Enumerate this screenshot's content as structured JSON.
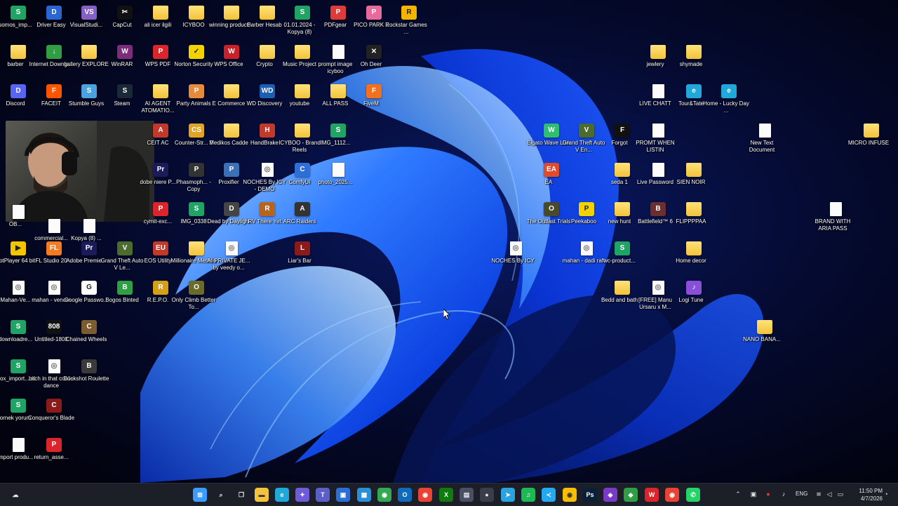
{
  "icons": [
    {
      "label": "somos_imp...",
      "glyph": "S",
      "type": "app",
      "color": "#21a366"
    },
    {
      "label": "Driver Easy",
      "glyph": "D",
      "type": "app",
      "color": "#2a66d1"
    },
    {
      "label": "VisualStudi...",
      "glyph": "VS",
      "type": "app",
      "color": "#8661c5"
    },
    {
      "label": "CapCut",
      "glyph": "✂",
      "type": "app",
      "color": "#111111"
    },
    {
      "label": "ali icer ilgili",
      "glyph": "",
      "type": "folder",
      "color": "#f3c33b"
    },
    {
      "label": "ICYBOO",
      "glyph": "",
      "type": "folder",
      "color": "#f3c33b"
    },
    {
      "label": "winning product",
      "glyph": "",
      "type": "folder",
      "color": "#f3c33b"
    },
    {
      "label": "Barber Hesab",
      "glyph": "",
      "type": "folder",
      "color": "#f3c33b"
    },
    {
      "label": "01.01.2024 - Kopya (8)",
      "glyph": "S",
      "type": "app",
      "color": "#21a366"
    },
    {
      "label": "PDFgear",
      "glyph": "P",
      "type": "app",
      "color": "#e03b3b"
    },
    {
      "label": "PICO PARK 2",
      "glyph": "P",
      "type": "app",
      "color": "#e86a9c"
    },
    {
      "label": "Rockstar Games ...",
      "glyph": "R",
      "type": "app",
      "color": "#f5b400"
    },
    {
      "label": "barber",
      "glyph": "",
      "type": "folder",
      "color": "#f3c33b"
    },
    {
      "label": "Internet Downlo...",
      "glyph": "↓",
      "type": "app",
      "color": "#2f9e44"
    },
    {
      "label": "gallery EXPLORE",
      "glyph": "",
      "type": "folder",
      "color": "#f3c33b"
    },
    {
      "label": "WinRAR",
      "glyph": "W",
      "type": "app",
      "color": "#7b2c7b"
    },
    {
      "label": "WPS PDF",
      "glyph": "P",
      "type": "app",
      "color": "#d9252b"
    },
    {
      "label": "Norton Security",
      "glyph": "✓",
      "type": "app",
      "color": "#f2d200"
    },
    {
      "label": "WPS Office",
      "glyph": "W",
      "type": "app",
      "color": "#c9202a"
    },
    {
      "label": "Crypto",
      "glyph": "",
      "type": "folder",
      "color": "#f3c33b"
    },
    {
      "label": "Music Project",
      "glyph": "",
      "type": "folder",
      "color": "#f3c33b"
    },
    {
      "label": "prompt image icyboo",
      "glyph": "",
      "type": "doc",
      "color": "#fbfbfb"
    },
    {
      "label": "Oh Deer",
      "glyph": "✕",
      "type": "app",
      "color": "#222222"
    },
    {
      "label": "Discord",
      "glyph": "D",
      "type": "app",
      "color": "#5865f2"
    },
    {
      "label": "FACEIT",
      "glyph": "F",
      "type": "app",
      "color": "#ff5500"
    },
    {
      "label": "Stumble Guys",
      "glyph": "S",
      "type": "app",
      "color": "#4aa3df"
    },
    {
      "label": "Steam",
      "glyph": "S",
      "type": "app",
      "color": "#1b2838"
    },
    {
      "label": "AI AGENT ATOMATIO...",
      "glyph": "",
      "type": "folder",
      "color": "#f3c33b"
    },
    {
      "label": "Party Animals",
      "glyph": "P",
      "type": "app",
      "color": "#e58b3a"
    },
    {
      "label": "E Commerce",
      "glyph": "",
      "type": "folder",
      "color": "#f3c33b"
    },
    {
      "label": "WD Discovery",
      "glyph": "WD",
      "type": "app",
      "color": "#1a5fb4"
    },
    {
      "label": "youtube",
      "glyph": "",
      "type": "folder",
      "color": "#f3c33b"
    },
    {
      "label": "ALL PASS",
      "glyph": "",
      "type": "folder",
      "color": "#f3c33b"
    },
    {
      "label": "FiveM",
      "glyph": "F",
      "type": "app",
      "color": "#f37021"
    },
    {
      "label": "CEIT AC",
      "glyph": "A",
      "type": "app",
      "color": "#c0392b"
    },
    {
      "label": "Counter-Str... 2",
      "glyph": "CS",
      "type": "app",
      "color": "#e0a526"
    },
    {
      "label": "Medikos Cadde",
      "glyph": "",
      "type": "folder",
      "color": "#c9a25b"
    },
    {
      "label": "HandBrake",
      "glyph": "H",
      "type": "app",
      "color": "#c0392b"
    },
    {
      "label": "ICYBOO - Brand Reels",
      "glyph": "",
      "type": "folder",
      "color": "#f3c33b"
    },
    {
      "label": "IMG_1112...",
      "glyph": "S",
      "type": "app",
      "color": "#21a366"
    },
    {
      "label": "dobe niere P...",
      "glyph": "Pr",
      "type": "app",
      "color": "#1b1b5a"
    },
    {
      "label": "Phasmoph... - Copy",
      "glyph": "P",
      "type": "app",
      "color": "#333333"
    },
    {
      "label": "Proxifier",
      "glyph": "P",
      "type": "app",
      "color": "#3b6fb6"
    },
    {
      "label": "NOCHES By ICY - DEMO",
      "glyph": "◎",
      "type": "doc",
      "color": "#fbfbfb"
    },
    {
      "label": "ComfyUI",
      "glyph": "C",
      "type": "app",
      "color": "#2d6fd6"
    },
    {
      "label": "photo_2025...",
      "glyph": "",
      "type": "doc",
      "color": "#cccccc"
    },
    {
      "label": "cymit-exc...",
      "glyph": "P",
      "type": "app",
      "color": "#d9252b"
    },
    {
      "label": "IMG_0338",
      "glyph": "S",
      "type": "app",
      "color": "#21a366"
    },
    {
      "label": "Dead by Daylight",
      "glyph": "D",
      "type": "app",
      "color": "#444444"
    },
    {
      "label": "RV There Yet",
      "glyph": "R",
      "type": "app",
      "color": "#b5651d"
    },
    {
      "label": "ARC Raiders",
      "glyph": "A",
      "type": "app",
      "color": "#333333"
    },
    {
      "label": "PotPlayer 64 bit",
      "glyph": "▶",
      "type": "app",
      "color": "#f2c500"
    },
    {
      "label": "FL Studio 20",
      "glyph": "FL",
      "type": "app",
      "color": "#f47b20"
    },
    {
      "label": "Adobe Premie...",
      "glyph": "Pr",
      "type": "app",
      "color": "#1b1b5a"
    },
    {
      "label": "Grand Theft Auto V Le...",
      "glyph": "V",
      "type": "app",
      "color": "#4c6b2f"
    },
    {
      "label": "EOS Utility",
      "glyph": "EU",
      "type": "app",
      "color": "#c0392b"
    },
    {
      "label": "Millionaire Method",
      "glyph": "",
      "type": "folder",
      "color": "#f3c33b"
    },
    {
      "label": "AI PRIVATE JE... by veedy o...",
      "glyph": "◎",
      "type": "doc",
      "color": "#fbfbfb"
    },
    {
      "label": "Liar's Bar",
      "glyph": "L",
      "type": "app",
      "color": "#8b1a1a"
    },
    {
      "label": "Mahan-Ve...",
      "glyph": "◎",
      "type": "doc",
      "color": "#fbfbfb"
    },
    {
      "label": "mahan - venom",
      "glyph": "◎",
      "type": "doc",
      "color": "#fbfbfb"
    },
    {
      "label": "Google Passwo...",
      "glyph": "G",
      "type": "app",
      "color": "#ffffff"
    },
    {
      "label": "Bogos Binted",
      "glyph": "B",
      "type": "app",
      "color": "#2f9e44"
    },
    {
      "label": "R.E.P.O.",
      "glyph": "R",
      "type": "app",
      "color": "#d4a017"
    },
    {
      "label": "Only Climb Better To...",
      "glyph": "O",
      "type": "app",
      "color": "#6b6b2a"
    },
    {
      "label": "downloadre...",
      "glyph": "S",
      "type": "app",
      "color": "#21a366"
    },
    {
      "label": "Untitled-1808",
      "glyph": "808",
      "type": "app",
      "color": "#111111"
    },
    {
      "label": "Chained Wheels",
      "glyph": "C",
      "type": "app",
      "color": "#7a5c2e"
    },
    {
      "label": "loox_import... ai",
      "glyph": "S",
      "type": "app",
      "color": "#21a366"
    },
    {
      "label": "bitch in that coolie dance",
      "glyph": "◎",
      "type": "doc",
      "color": "#fbfbfb"
    },
    {
      "label": "Buckshot Roulette",
      "glyph": "B",
      "type": "app",
      "color": "#3a3a3a"
    },
    {
      "label": "ornek yorum",
      "glyph": "S",
      "type": "app",
      "color": "#21a366"
    },
    {
      "label": "Conqueror's Blade",
      "glyph": "C",
      "type": "app",
      "color": "#8b1a1a"
    },
    {
      "label": "import produ...",
      "glyph": "",
      "type": "doc",
      "color": "#fbfbfb"
    },
    {
      "label": "return_asse...",
      "glyph": "P",
      "type": "app",
      "color": "#d9252b"
    },
    {
      "label": "jewlery",
      "glyph": "",
      "type": "folder",
      "color": "#f3c33b"
    },
    {
      "label": "shymade",
      "glyph": "",
      "type": "folder",
      "color": "#f3c33b"
    },
    {
      "label": "LIVE CHATT",
      "glyph": "",
      "type": "doc",
      "color": "#fbfbfb"
    },
    {
      "label": "Tour&Tate",
      "glyph": "e",
      "type": "app",
      "color": "#1fa8d9"
    },
    {
      "label": "Home - Lucky Day ...",
      "glyph": "e",
      "type": "app",
      "color": "#1fa8d9"
    },
    {
      "label": "Elgato Wave Link",
      "glyph": "W",
      "type": "app",
      "color": "#2fbf71"
    },
    {
      "label": "Grand Theft Auto V En...",
      "glyph": "V",
      "type": "app",
      "color": "#4c6b2f"
    },
    {
      "label": "Forgot",
      "glyph": "F",
      "type": "app",
      "color": "#111111"
    },
    {
      "label": "PROMT WHEN LISTIN",
      "glyph": "",
      "type": "doc",
      "color": "#fbfbfb"
    },
    {
      "label": "New Text Document",
      "glyph": "",
      "type": "doc",
      "color": "#fbfbfb"
    },
    {
      "label": "MICRO INFUSE",
      "glyph": "",
      "type": "folder",
      "color": "#f3c33b"
    },
    {
      "label": "EA",
      "glyph": "EA",
      "type": "app",
      "color": "#e14b2b"
    },
    {
      "label": "seda 1",
      "glyph": "",
      "type": "folder",
      "color": "#f3c33b"
    },
    {
      "label": "Live Password",
      "glyph": "",
      "type": "doc",
      "color": "#fbfbfb"
    },
    {
      "label": "SIEN NOIR",
      "glyph": "",
      "type": "folder",
      "color": "#d4a017"
    },
    {
      "label": "The Outlast Trials",
      "glyph": "O",
      "type": "app",
      "color": "#4a4a2a"
    },
    {
      "label": "Peekaboo",
      "glyph": "P",
      "type": "app",
      "color": "#f2d200"
    },
    {
      "label": "new hunt",
      "glyph": "",
      "type": "folder",
      "color": "#f3c33b"
    },
    {
      "label": "Battlefield™ 6",
      "glyph": "B",
      "type": "app",
      "color": "#6b2f2f"
    },
    {
      "label": "FLIPPPPAA",
      "glyph": "",
      "type": "folder",
      "color": "#f3c33b"
    },
    {
      "label": "BRAND WITH ARIA PASS",
      "glyph": "",
      "type": "doc",
      "color": "#fbfbfb"
    },
    {
      "label": "NOCHES By ICY",
      "glyph": "◎",
      "type": "doc",
      "color": "#fbfbfb"
    },
    {
      "label": "mahan - dadi raft",
      "glyph": "◎",
      "type": "doc",
      "color": "#fbfbfb"
    },
    {
      "label": "wc-product...",
      "glyph": "S",
      "type": "app",
      "color": "#21a366"
    },
    {
      "label": "Home decor",
      "glyph": "",
      "type": "folder",
      "color": "#f3c33b"
    },
    {
      "label": "Bedd and bath",
      "glyph": "",
      "type": "folder",
      "color": "#f3c33b"
    },
    {
      "label": "[FREE] Manu Ursaru x M...",
      "glyph": "◎",
      "type": "doc",
      "color": "#fbfbfb"
    },
    {
      "label": "Logi Tune",
      "glyph": "♪",
      "type": "app",
      "color": "#8a4fd8"
    },
    {
      "label": "NANO BANA...",
      "glyph": "",
      "type": "folder",
      "color": "#f3c33b"
    },
    {
      "label": "commercial...",
      "glyph": "",
      "type": "doc",
      "color": "#fbfbfb"
    },
    {
      "label": "Kopya (8) ...",
      "glyph": "",
      "type": "doc",
      "color": "#fbfbfb"
    },
    {
      "label": "OB...",
      "glyph": "",
      "type": "doc",
      "color": "#fbfbfb"
    }
  ],
  "webcam": {
    "label": "webcam-overlay"
  },
  "taskbar": {
    "apps": [
      {
        "name": "windows-start-icon",
        "glyph": "⊞",
        "color": "#3b9cff"
      },
      {
        "name": "search-icon",
        "glyph": "⌕",
        "color": "#1c1f28"
      },
      {
        "name": "task-view-icon",
        "glyph": "❐",
        "color": "#1c1f28"
      },
      {
        "name": "file-explorer-icon",
        "glyph": "▬",
        "color": "#f3c33b"
      },
      {
        "name": "edge-icon",
        "glyph": "e",
        "color": "#1fa8d9"
      },
      {
        "name": "copilot-icon",
        "glyph": "✦",
        "color": "#6f5bd8"
      },
      {
        "name": "teams-icon",
        "glyph": "T",
        "color": "#5b5fc7"
      },
      {
        "name": "app-icon",
        "glyph": "▣",
        "color": "#2b6fd6"
      },
      {
        "name": "store-icon",
        "glyph": "▦",
        "color": "#2b8fd6"
      },
      {
        "name": "chrome-icon",
        "glyph": "◉",
        "color": "#34a853"
      },
      {
        "name": "outlook-icon",
        "glyph": "O",
        "color": "#0f6cbd"
      },
      {
        "name": "chrome-icon-2",
        "glyph": "◉",
        "color": "#ea4335"
      },
      {
        "name": "xbox-icon",
        "glyph": "X",
        "color": "#107c10"
      },
      {
        "name": "app-icon-2",
        "glyph": "▤",
        "color": "#4a4f63"
      },
      {
        "name": "app-icon-3",
        "glyph": "●",
        "color": "#3a3d4a"
      },
      {
        "name": "telegram-icon",
        "glyph": "➤",
        "color": "#2aa3de"
      },
      {
        "name": "spotify-icon",
        "glyph": "♫",
        "color": "#1db954"
      },
      {
        "name": "vscode-icon",
        "glyph": "≺",
        "color": "#23a9f2"
      },
      {
        "name": "chrome-icon-3",
        "glyph": "◉",
        "color": "#fbbc05"
      },
      {
        "name": "photoshop-icon",
        "glyph": "Ps",
        "color": "#0a1f3a"
      },
      {
        "name": "app-icon-4",
        "glyph": "◈",
        "color": "#7a3ac6"
      },
      {
        "name": "app-icon-5",
        "glyph": "◆",
        "color": "#2f9e44"
      },
      {
        "name": "wps-icon",
        "glyph": "W",
        "color": "#d9252b"
      },
      {
        "name": "chrome-icon-4",
        "glyph": "◉",
        "color": "#ea4335"
      },
      {
        "name": "whatsapp-icon",
        "glyph": "✆",
        "color": "#25d366"
      }
    ],
    "tray": {
      "lang": "ENG",
      "time": "11:50 PM",
      "date": "4/7/2026"
    }
  }
}
